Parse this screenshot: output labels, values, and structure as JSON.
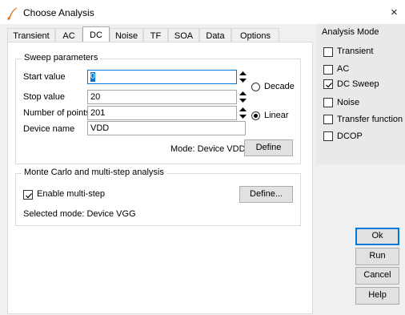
{
  "window": {
    "title": "Choose Analysis",
    "close_glyph": "×"
  },
  "tabs": [
    {
      "label": "Transient"
    },
    {
      "label": "AC"
    },
    {
      "label": "DC"
    },
    {
      "label": "Noise"
    },
    {
      "label": "TF"
    },
    {
      "label": "SOA"
    },
    {
      "label": "Data"
    },
    {
      "label": "Options"
    }
  ],
  "active_tab": "DC",
  "sweep": {
    "title": "Sweep parameters",
    "start_label": "Start value",
    "start_value": "0",
    "stop_label": "Stop value",
    "stop_value": "20",
    "points_label": "Number of points",
    "points_value": "201",
    "device_label": "Device name",
    "device_value": "VDD",
    "decade_label": "Decade",
    "linear_label": "Linear",
    "selected_scale": "Linear",
    "mode_text": "Mode: Device VDD",
    "define_label": "Define"
  },
  "montecarlo": {
    "title": "Monte Carlo and multi-step analysis",
    "enable_label": "Enable multi-step",
    "enable_checked": true,
    "define_label": "Define...",
    "selected_mode": "Selected mode: Device VGG"
  },
  "analysis_mode": {
    "title": "Analysis Mode",
    "items": [
      {
        "label": "Transient",
        "checked": false
      },
      {
        "label": "AC",
        "checked": false
      },
      {
        "label": "DC Sweep",
        "checked": true
      },
      {
        "label": "Noise",
        "checked": false
      },
      {
        "label": "Transfer function",
        "checked": false
      },
      {
        "label": "DCOP",
        "checked": false
      }
    ]
  },
  "buttons": {
    "ok": "Ok",
    "run": "Run",
    "cancel": "Cancel",
    "help": "Help"
  },
  "colors": {
    "accent": "#0078d7",
    "app_icon": "#f5a623"
  }
}
